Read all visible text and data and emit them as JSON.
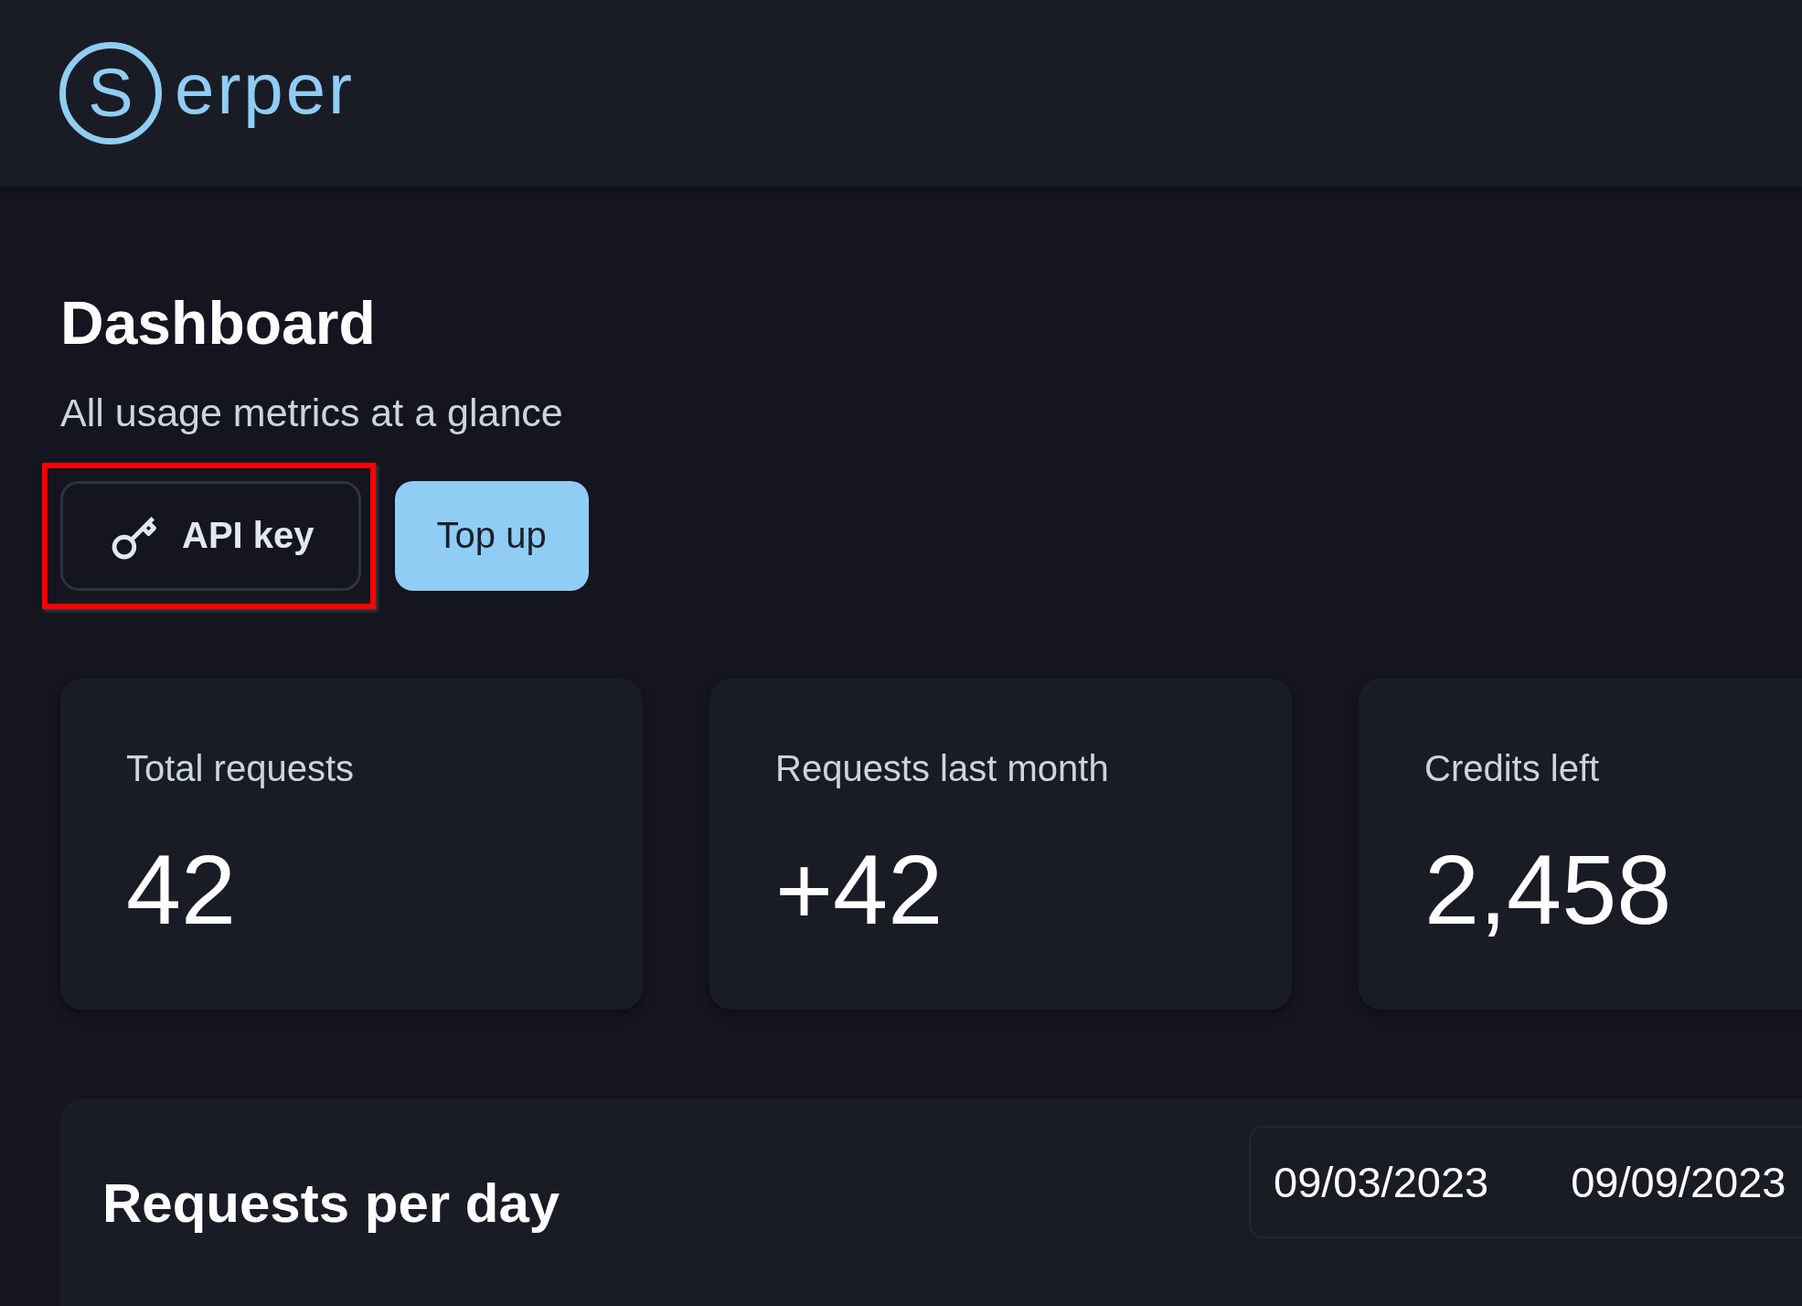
{
  "logo": {
    "mark": "S",
    "text": "erper"
  },
  "header": {
    "title": "Dashboard",
    "subtitle": "All usage metrics at a glance"
  },
  "buttons": [
    {
      "label": "API key",
      "kind": "outline",
      "highlighted": true
    },
    {
      "label": "Top up",
      "kind": "primary",
      "highlighted": false
    }
  ],
  "stats": [
    {
      "label": "Total requests",
      "value": "42"
    },
    {
      "label": "Requests last month",
      "value": "+42"
    },
    {
      "label": "Credits left",
      "value": "2,458"
    }
  ],
  "chart_panel": {
    "title": "Requests per day",
    "date_range": {
      "start": "09/03/2023",
      "end": "09/09/2023"
    }
  }
}
